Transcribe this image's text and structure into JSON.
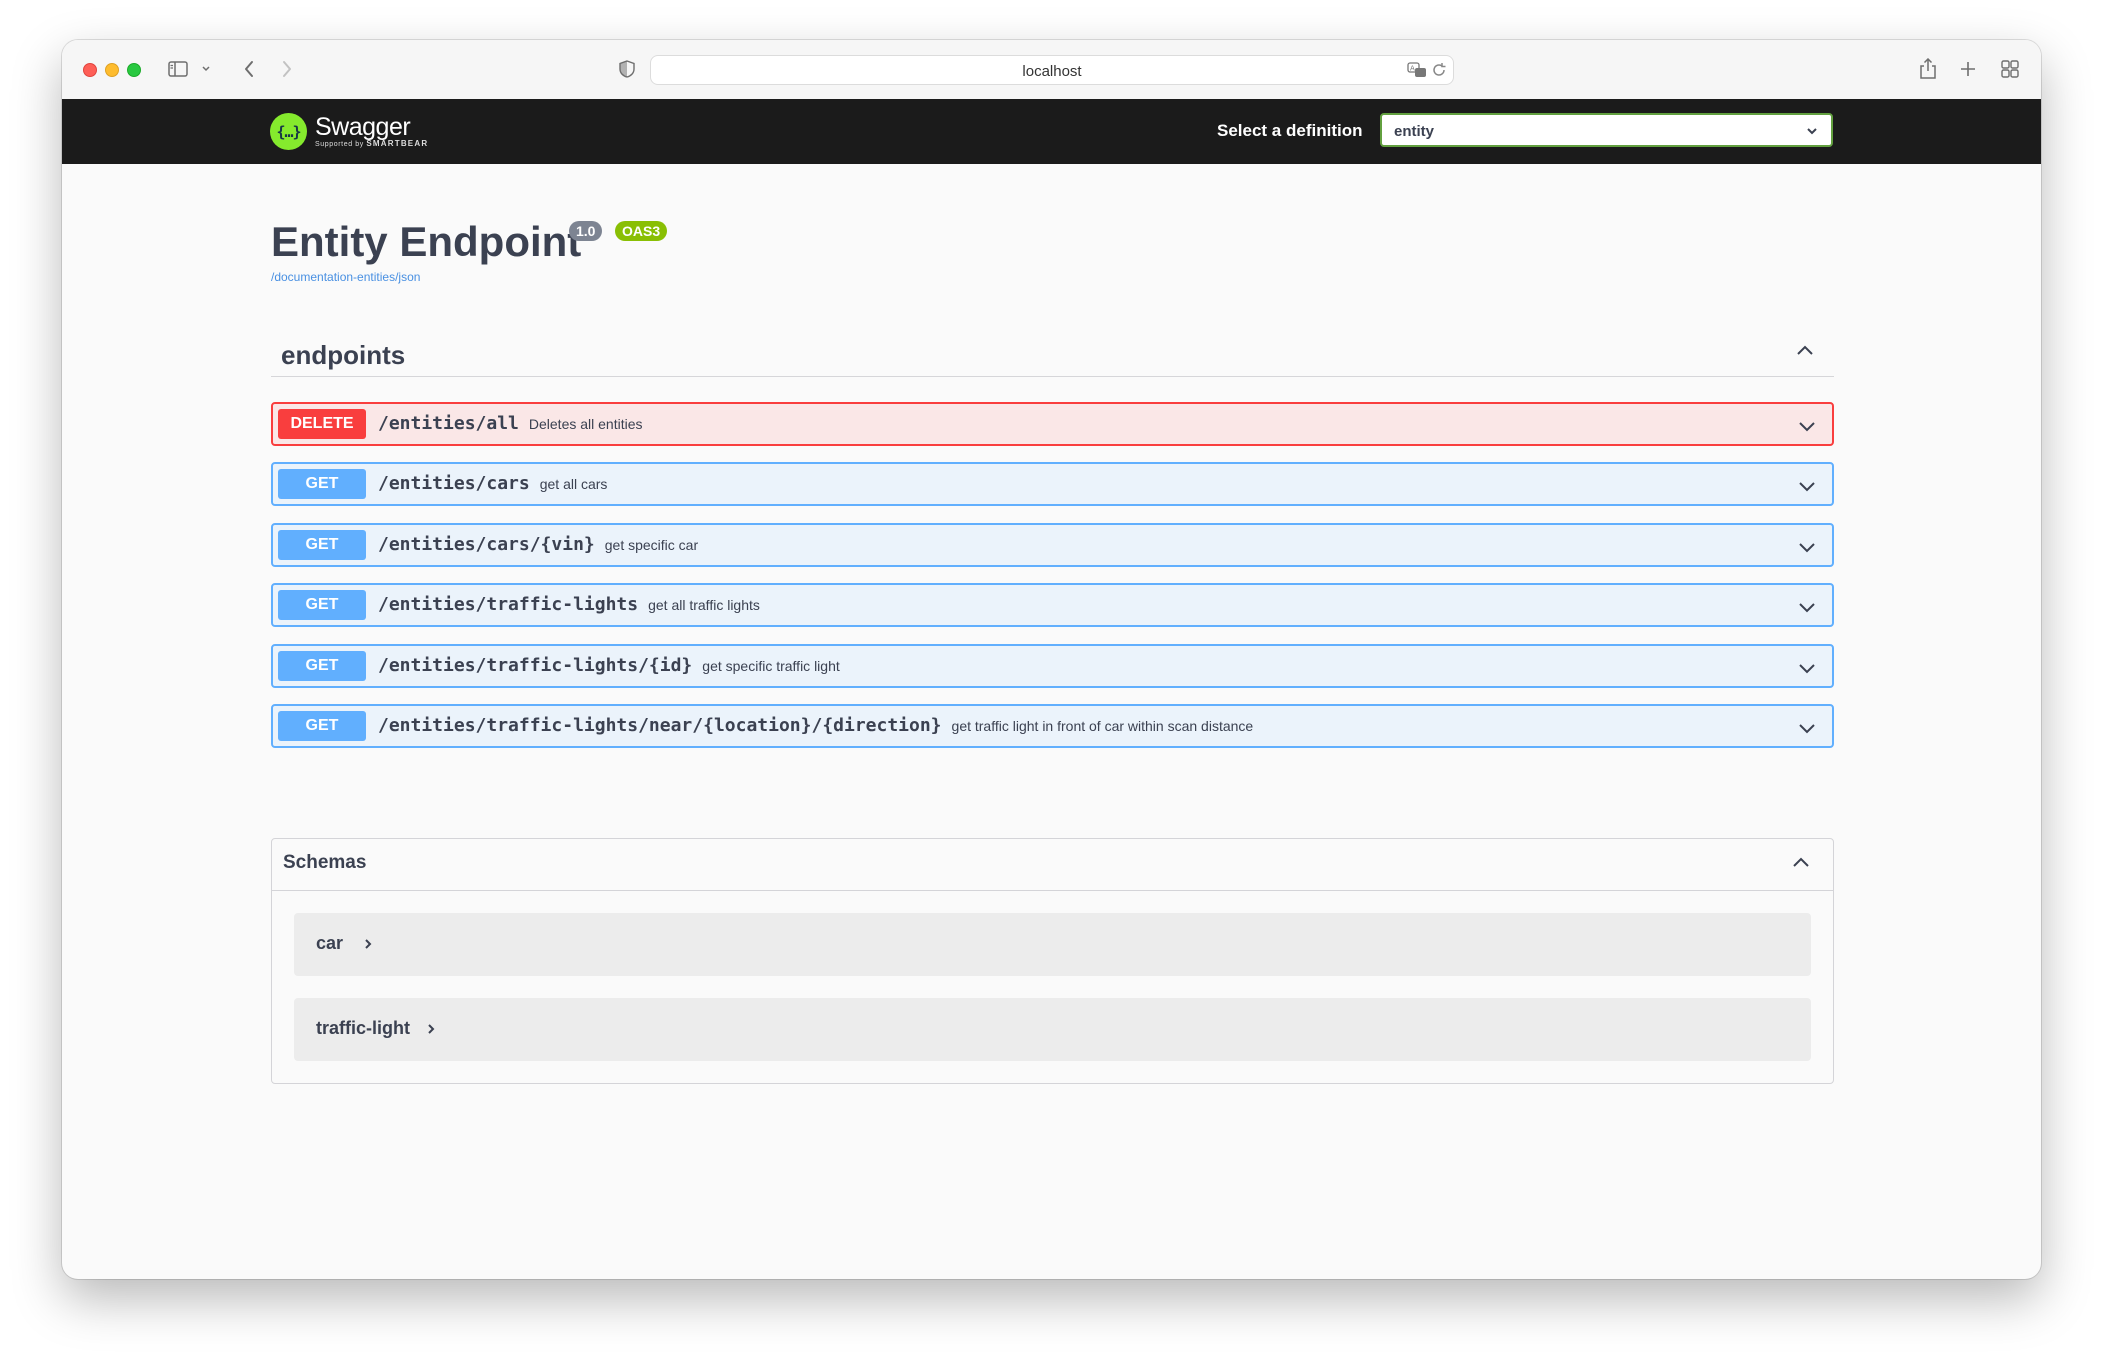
{
  "browser": {
    "url": "localhost"
  },
  "topbar": {
    "logo_name": "Swagger",
    "logo_sub_prefix": "Supported by",
    "logo_sub_brand": "SMARTBEAR",
    "definition_label": "Select a definition",
    "definition_value": "entity"
  },
  "info": {
    "title": "Entity Endpoint",
    "version": "1.0",
    "oas": "OAS3",
    "url": "/documentation-entities/json"
  },
  "tag": {
    "name": "endpoints"
  },
  "operations": [
    {
      "method": "DELETE",
      "path": "/entities/all",
      "summary": "Deletes all entities"
    },
    {
      "method": "GET",
      "path": "/entities/cars",
      "summary": "get all cars"
    },
    {
      "method": "GET",
      "path": "/entities/cars/{vin}",
      "summary": "get specific car"
    },
    {
      "method": "GET",
      "path": "/entities/traffic-lights",
      "summary": "get all traffic lights"
    },
    {
      "method": "GET",
      "path": "/entities/traffic-lights/{id}",
      "summary": "get specific traffic light"
    },
    {
      "method": "GET",
      "path": "/entities/traffic-lights/near/{location}/{direction}",
      "summary": "get traffic light in front of car within scan distance"
    }
  ],
  "schemas": {
    "title": "Schemas",
    "items": [
      "car",
      "traffic-light"
    ]
  },
  "colors": {
    "delete": "#f93e3e",
    "get": "#61affe",
    "swagger_green": "#85ea2d",
    "topbar": "#1b1b1b"
  }
}
